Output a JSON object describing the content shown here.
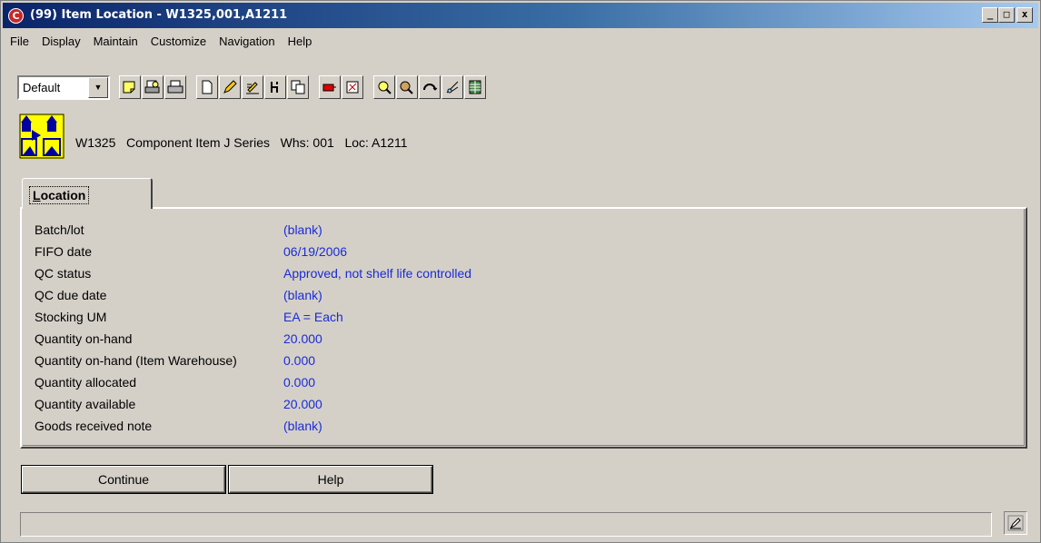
{
  "window": {
    "title": "(99) Item Location - W1325,001,A1211",
    "app_icon_glyph": "C",
    "minimize": "_",
    "maximize": "□",
    "close": "x"
  },
  "menu": [
    "File",
    "Display",
    "Maintain",
    "Customize",
    "Navigation",
    "Help"
  ],
  "toolbar": {
    "view_select": "Default",
    "icons": [
      "note-icon",
      "print-preview-icon",
      "print-icon",
      "new-document-icon",
      "edit-pencil-icon",
      "edit-list-icon",
      "filter-icon",
      "copy-icon",
      "flag-icon",
      "tools-icon",
      "search-gear-icon",
      "search-list-icon",
      "refresh-icon",
      "link-icon",
      "spreadsheet-icon"
    ]
  },
  "item_header": {
    "icon": "item-location-icon",
    "text": "W1325   Component Item J Series   Whs: 001   Loc: A1211"
  },
  "tabs": [
    {
      "label_prefix": "L",
      "label_rest": "ocation"
    }
  ],
  "fields": [
    {
      "label": "Batch/lot",
      "value": "(blank)"
    },
    {
      "label": "FIFO date",
      "value": "06/19/2006"
    },
    {
      "label": "QC status",
      "value": "Approved, not shelf life controlled"
    },
    {
      "label": "QC due date",
      "value": "(blank)"
    },
    {
      "label": "Stocking UM",
      "value": "EA = Each"
    },
    {
      "label": "Quantity on-hand",
      "value": "20.000"
    },
    {
      "label": "Quantity on-hand (Item Warehouse)",
      "value": "0.000"
    },
    {
      "label": "Quantity allocated",
      "value": "0.000"
    },
    {
      "label": "Quantity available",
      "value": "20.000"
    },
    {
      "label": "Goods received note",
      "value": "(blank)"
    }
  ],
  "buttons": {
    "continue": "Continue",
    "help": "Help"
  },
  "statusbar": {
    "text": "",
    "icon": "pen-icon"
  },
  "colors": {
    "value_text": "#1a2bd8",
    "title_bar_start": "#0a246a",
    "title_bar_end": "#a6caf0",
    "app_icon": "#c62828",
    "window_bg": "#d4d0c8"
  }
}
